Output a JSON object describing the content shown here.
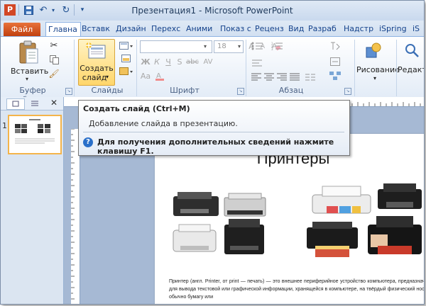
{
  "window": {
    "title": "Презентация1 - Microsoft PowerPoint"
  },
  "tabs": {
    "file": "Файл",
    "items": [
      "Главна",
      "Вставк",
      "Дизайн",
      "Перехс",
      "Аними",
      "Показ с",
      "Реценз",
      "Вид",
      "Разраб",
      "Надстр",
      "iSpring",
      "iS"
    ]
  },
  "ribbon": {
    "paste_label": "Вставить",
    "new_slide_label_1": "Создать",
    "new_slide_label_2": "слайд",
    "font_size": "18",
    "drawing_label": "Рисование",
    "editing_label": "Редакт",
    "group_clipboard": "Буфер обмена",
    "group_slides": "Слайды",
    "group_font": "Шрифт",
    "group_paragraph": "Абзац"
  },
  "left_pane": {
    "slide_number": "1"
  },
  "tooltip": {
    "title": "Создать слайд (Ctrl+M)",
    "description": "Добавление слайда в презентацию.",
    "help": "Для получения дополнительных сведений нажмите клавишу F1."
  },
  "slide": {
    "title": "Принтеры",
    "body": "Принтер (англ. Printer, от print — печать) — это внешнее периферийное устройство компьютера, предназначенное для вывода текстовой или графической информации, хранящейся в компьютере, на твёрдый физический носитель, обычно бумагу или"
  },
  "colors": {
    "file_tab": "#d5531c",
    "accent": "#15428b",
    "tooltip_help_icon": "#2a6fc9"
  }
}
